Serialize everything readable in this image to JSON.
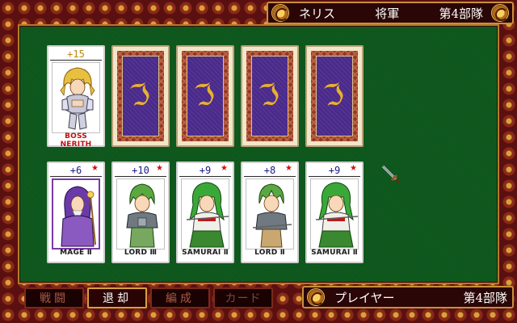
{
  "header": {
    "commander_name": "ネリス",
    "rank": "将軍",
    "unit": "第4部隊"
  },
  "enemy_cards": [
    {
      "cost": "+15",
      "label": "BOSS NERITH",
      "face_up": true
    },
    {
      "face_up": false
    },
    {
      "face_up": false
    },
    {
      "face_up": false
    },
    {
      "face_up": false
    }
  ],
  "player_cards": [
    {
      "cost": "+6",
      "label": "MAGE Ⅱ",
      "star": "★"
    },
    {
      "cost": "+10",
      "label": "LORD Ⅲ",
      "star": "★"
    },
    {
      "cost": "+9",
      "label": "SAMURAI Ⅱ",
      "star": "★"
    },
    {
      "cost": "+8",
      "label": "LORD Ⅱ",
      "star": "★"
    },
    {
      "cost": "+9",
      "label": "SAMURAI Ⅱ",
      "star": "★"
    }
  ],
  "commands": {
    "battle": "戦闘",
    "retreat": "退却",
    "formation": "編成",
    "card": "カード"
  },
  "player_bar": {
    "name": "プレイヤー",
    "unit": "第4部隊"
  },
  "card_back_symbol": "ℑ",
  "icons": [
    "medallion-icon",
    "sword-cursor-icon",
    "dragon-emblem-icon",
    "star-icon"
  ],
  "colors": {
    "felt": "#0f5a1e",
    "frame": "#5a1010",
    "gold_trim": "#c8903a",
    "cost_blue": "#1a1a8a",
    "cost_gold": "#b88a18",
    "star_red": "#d01010"
  }
}
